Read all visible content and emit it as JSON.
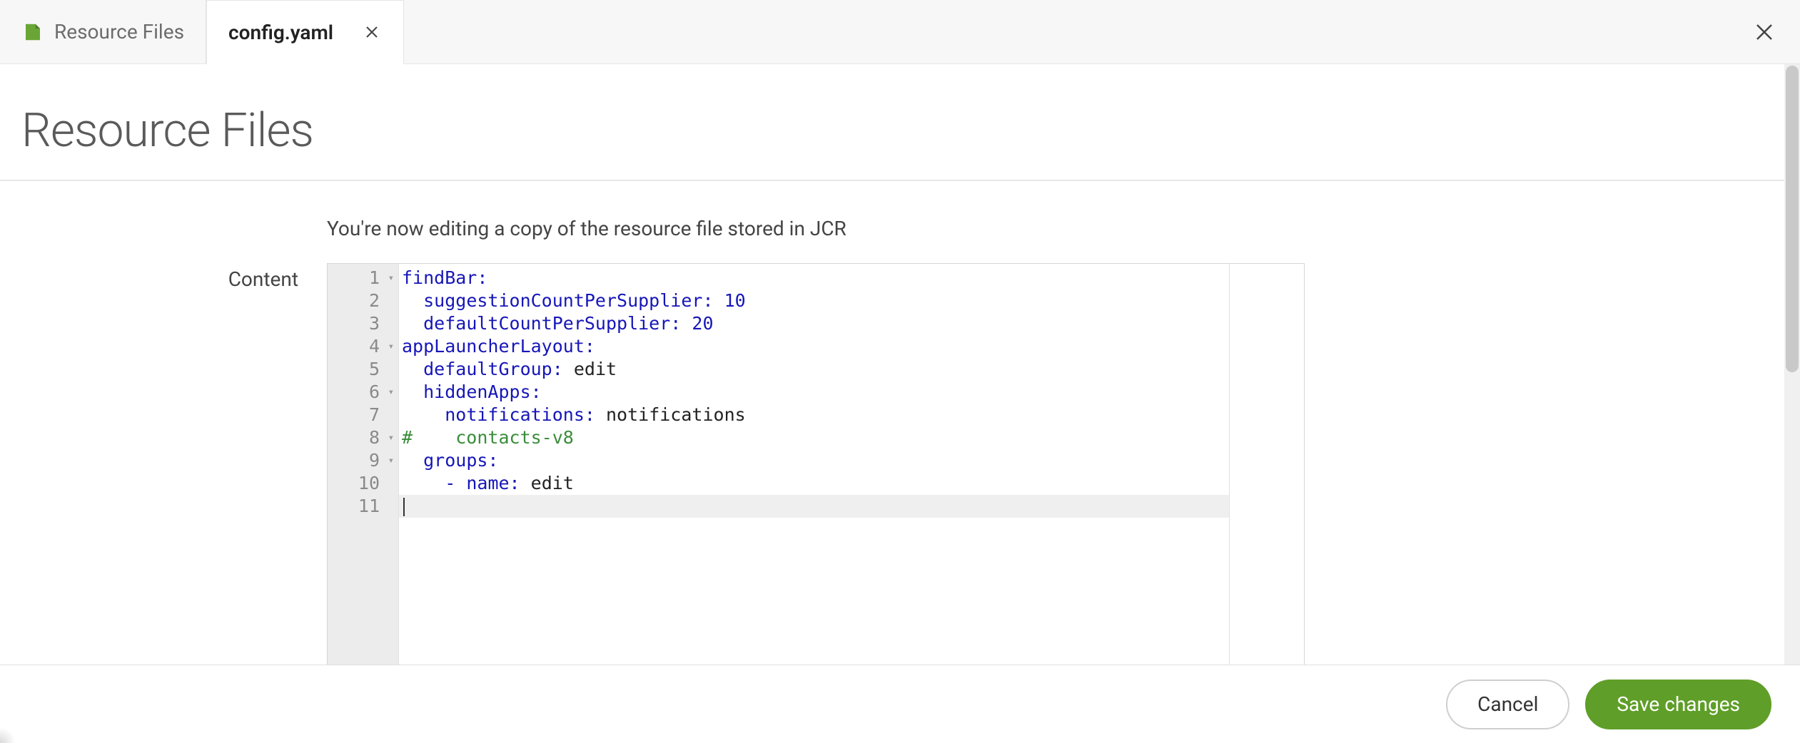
{
  "tabs": {
    "resourceFiles": {
      "label": "Resource Files"
    },
    "configYaml": {
      "label": "config.yaml"
    }
  },
  "page": {
    "title": "Resource Files",
    "info": "You're now editing a copy of the resource file stored in JCR",
    "contentLabel": "Content"
  },
  "editor": {
    "lines": [
      {
        "n": "1",
        "fold": true,
        "tokens": [
          {
            "t": "findBar:",
            "c": "tok-key"
          }
        ]
      },
      {
        "n": "2",
        "fold": false,
        "tokens": [
          {
            "t": "  ",
            "c": ""
          },
          {
            "t": "suggestionCountPerSupplier:",
            "c": "tok-key"
          },
          {
            "t": " ",
            "c": ""
          },
          {
            "t": "10",
            "c": "tok-num"
          }
        ]
      },
      {
        "n": "3",
        "fold": false,
        "tokens": [
          {
            "t": "  ",
            "c": ""
          },
          {
            "t": "defaultCountPerSupplier:",
            "c": "tok-key"
          },
          {
            "t": " ",
            "c": ""
          },
          {
            "t": "20",
            "c": "tok-num"
          }
        ]
      },
      {
        "n": "4",
        "fold": true,
        "tokens": [
          {
            "t": "appLauncherLayout:",
            "c": "tok-key"
          }
        ]
      },
      {
        "n": "5",
        "fold": false,
        "tokens": [
          {
            "t": "  ",
            "c": ""
          },
          {
            "t": "defaultGroup:",
            "c": "tok-key"
          },
          {
            "t": " ",
            "c": ""
          },
          {
            "t": "edit",
            "c": "tok-str"
          }
        ]
      },
      {
        "n": "6",
        "fold": true,
        "tokens": [
          {
            "t": "  ",
            "c": ""
          },
          {
            "t": "hiddenApps:",
            "c": "tok-key"
          }
        ]
      },
      {
        "n": "7",
        "fold": false,
        "tokens": [
          {
            "t": "    ",
            "c": ""
          },
          {
            "t": "notifications:",
            "c": "tok-key"
          },
          {
            "t": " ",
            "c": ""
          },
          {
            "t": "notifications",
            "c": "tok-str"
          }
        ]
      },
      {
        "n": "8",
        "fold": true,
        "tokens": [
          {
            "t": "#    contacts-v8",
            "c": "tok-comment"
          }
        ]
      },
      {
        "n": "9",
        "fold": true,
        "tokens": [
          {
            "t": "  ",
            "c": ""
          },
          {
            "t": "groups:",
            "c": "tok-key"
          }
        ]
      },
      {
        "n": "10",
        "fold": false,
        "tokens": [
          {
            "t": "    ",
            "c": ""
          },
          {
            "t": "-",
            "c": "tok-dash"
          },
          {
            "t": " ",
            "c": ""
          },
          {
            "t": "name:",
            "c": "tok-key"
          },
          {
            "t": " ",
            "c": ""
          },
          {
            "t": "edit",
            "c": "tok-str"
          }
        ]
      },
      {
        "n": "11",
        "fold": false,
        "active": true,
        "tokens": []
      }
    ]
  },
  "footer": {
    "cancel": "Cancel",
    "save": "Save changes"
  }
}
